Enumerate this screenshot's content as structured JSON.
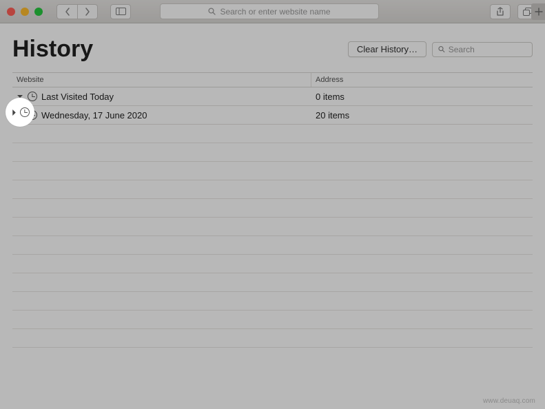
{
  "toolbar": {
    "url_placeholder": "Search or enter website name"
  },
  "page": {
    "title": "History",
    "clear_label": "Clear History…",
    "search_placeholder": "Search"
  },
  "columns": {
    "website": "Website",
    "address": "Address"
  },
  "rows": [
    {
      "expanded": true,
      "label": "Last Visited Today",
      "address": "0 items"
    },
    {
      "expanded": false,
      "label": "Wednesday, 17 June 2020",
      "address": "20 items"
    }
  ],
  "watermark": "www.deuaq.com"
}
